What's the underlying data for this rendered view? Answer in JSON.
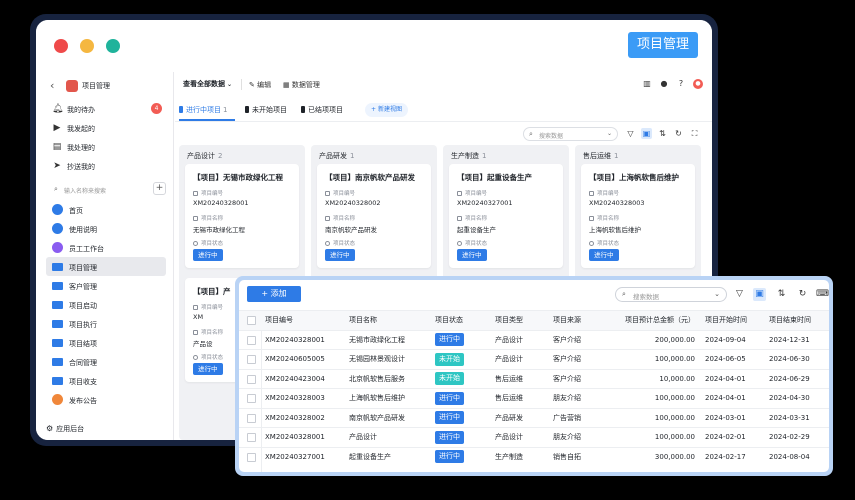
{
  "window": {
    "title": "项目管理",
    "colors": {
      "brand": "#3b9bf6",
      "accent": "#2e7be6",
      "running": "#2e7be6",
      "not_started": "#2ec6c3",
      "notification": "#f25c54"
    }
  },
  "sidebar": {
    "app_name": "项目管理",
    "top_items": [
      {
        "label": "我的待办",
        "icon": "bell-icon",
        "badge": "4"
      },
      {
        "label": "我发起的",
        "icon": "play-circle-icon"
      },
      {
        "label": "我处理的",
        "icon": "document-icon"
      },
      {
        "label": "抄送我的",
        "icon": "send-icon"
      }
    ],
    "search_placeholder": "输入名称来搜索",
    "nav_items": [
      {
        "label": "首页",
        "icon": "home-icon"
      },
      {
        "label": "使用说明",
        "icon": "info-icon"
      },
      {
        "label": "员工工作台",
        "icon": "user-workbench-icon"
      },
      {
        "label": "项目管理",
        "icon": "folder-icon"
      },
      {
        "label": "客户管理",
        "icon": "folder-icon"
      },
      {
        "label": "项目启动",
        "icon": "folder-icon"
      },
      {
        "label": "项目执行",
        "icon": "folder-icon"
      },
      {
        "label": "项目结项",
        "icon": "folder-icon"
      },
      {
        "label": "合同管理",
        "icon": "folder-icon"
      },
      {
        "label": "项目收支",
        "icon": "folder-icon"
      },
      {
        "label": "发布公告",
        "icon": "announcement-icon"
      }
    ],
    "active_item": "项目管理",
    "footer": "应用后台"
  },
  "toolbar": {
    "view_select": "查看全部数据",
    "edit_label": "编辑",
    "data_manage_label": "数据管理"
  },
  "tabs": [
    {
      "label": "进行中项目",
      "count": "1"
    },
    {
      "label": "未开始项目",
      "count": ""
    },
    {
      "label": "已结项项目",
      "count": ""
    }
  ],
  "new_view_label": "新建视图",
  "kanban_search_placeholder": "搜索数据",
  "kanban": [
    {
      "header": "产品设计",
      "count": "2",
      "cards": [
        {
          "title": "【项目】无锡市政绿化工程",
          "id_label": "项目编号",
          "id": "XM20240328001",
          "name_label": "项目名称",
          "name": "无锡市政绿化工程",
          "status_label": "项目状态",
          "status": "进行中"
        },
        {
          "title": "【项目】产",
          "id_label": "项目编号",
          "id": "XM",
          "name_label": "项目名称",
          "name": "产品设",
          "status_label": "项目状态",
          "status": "进行中"
        }
      ]
    },
    {
      "header": "产品研发",
      "count": "1",
      "cards": [
        {
          "title": "【项目】南京帆软产品研发",
          "id_label": "项目编号",
          "id": "XM20240328002",
          "name_label": "项目名称",
          "name": "南京帆软产品研发",
          "status_label": "项目状态",
          "status": "进行中"
        }
      ]
    },
    {
      "header": "生产制造",
      "count": "1",
      "cards": [
        {
          "title": "【项目】起重设备生产",
          "id_label": "项目编号",
          "id": "XM20240327001",
          "name_label": "项目名称",
          "name": "起重设备生产",
          "status_label": "项目状态",
          "status": "进行中"
        }
      ]
    },
    {
      "header": "售后运维",
      "count": "1",
      "cards": [
        {
          "title": "【项目】上海帆软售后维护",
          "id_label": "项目编号",
          "id": "XM20240328003",
          "name_label": "项目名称",
          "name": "上海帆软售后维护",
          "status_label": "项目状态",
          "status": "进行中"
        }
      ]
    }
  ],
  "table_window": {
    "add_label": "添加",
    "search_placeholder": "搜索数据",
    "columns": [
      "项目编号",
      "项目名称",
      "项目状态",
      "项目类型",
      "项目来源",
      "项目预计总金额（元）",
      "项目开始时间",
      "项目结束时间"
    ],
    "rows": [
      [
        "XM20240328001",
        "无锡市政绿化工程",
        "进行中",
        "产品设计",
        "客户介绍",
        "200,000.00",
        "2024-09-04",
        "2024-12-31"
      ],
      [
        "XM20240605005",
        "无锡园林景观设计",
        "未开始",
        "产品设计",
        "客户介绍",
        "100,000.00",
        "2024-06-05",
        "2024-06-30"
      ],
      [
        "XM20240423004",
        "北京帆软售后服务",
        "未开始",
        "售后运维",
        "客户介绍",
        "10,000.00",
        "2024-04-01",
        "2024-06-29"
      ],
      [
        "XM20240328003",
        "上海帆软售后维护",
        "进行中",
        "售后运维",
        "朋友介绍",
        "100,000.00",
        "2024-04-01",
        "2024-04-30"
      ],
      [
        "XM20240328002",
        "南京帆软产品研发",
        "进行中",
        "产品研发",
        "广告营销",
        "100,000.00",
        "2024-03-01",
        "2024-03-31"
      ],
      [
        "XM20240328001",
        "产品设计",
        "进行中",
        "产品设计",
        "朋友介绍",
        "100,000.00",
        "2024-02-01",
        "2024-02-29"
      ],
      [
        "XM20240327001",
        "起重设备生产",
        "进行中",
        "生产制造",
        "销售自拓",
        "300,000.00",
        "2024-02-17",
        "2024-08-04"
      ]
    ]
  }
}
